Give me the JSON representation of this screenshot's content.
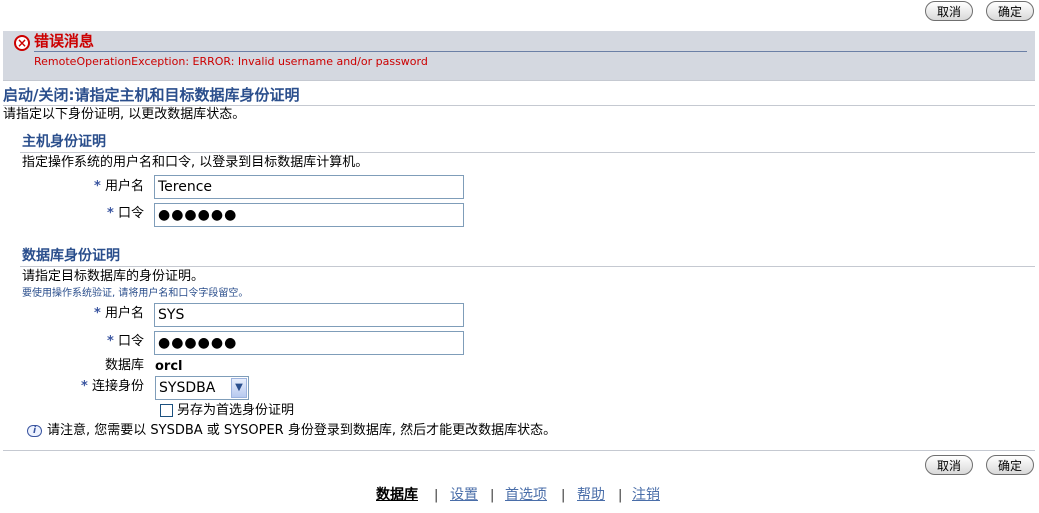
{
  "top_buttons": {
    "cancel": "取消",
    "ok": "确定"
  },
  "error": {
    "title": "错误消息",
    "message": "RemoteOperationException: ERROR: Invalid username and/or password"
  },
  "page": {
    "title": "启动/关闭:请指定主机和目标数据库身份证明",
    "intro": "请指定以下身份证明, 以更改数据库状态。"
  },
  "host": {
    "section_title": "主机身份证明",
    "description": "指定操作系统的用户名和口令, 以登录到目标数据库计算机。",
    "required_mark": "*",
    "username_label": "用户名",
    "username_value": "Terence",
    "password_label": "口令",
    "password_value": "●●●●●●"
  },
  "db": {
    "section_title": "数据库身份证明",
    "description": "请指定目标数据库的身份证明。",
    "hint": "要使用操作系统验证, 请将用户名和口令字段留空。",
    "required_mark": "*",
    "username_label": "用户名",
    "username_value": "SYS",
    "password_label": "口令",
    "password_value": "●●●●●●",
    "database_label": "数据库",
    "database_value": "orcl",
    "connect_as_label": "连接身份",
    "connect_as_value": "SYSDBA",
    "save_pref_label": "另存为首选身份证明",
    "note": "请注意, 您需要以 SYSDBA 或 SYSOPER 身份登录到数据库, 然后才能更改数据库状态。"
  },
  "bottom_buttons": {
    "cancel": "取消",
    "ok": "确定"
  },
  "footer_nav": {
    "database": "数据库",
    "setup": "设置",
    "preferences": "首选项",
    "help": "帮助",
    "logout": "注销",
    "separator": "|"
  },
  "icons": {
    "error": "error-x-icon",
    "info": "info-icon",
    "dropdown": "chevron-down-icon"
  }
}
